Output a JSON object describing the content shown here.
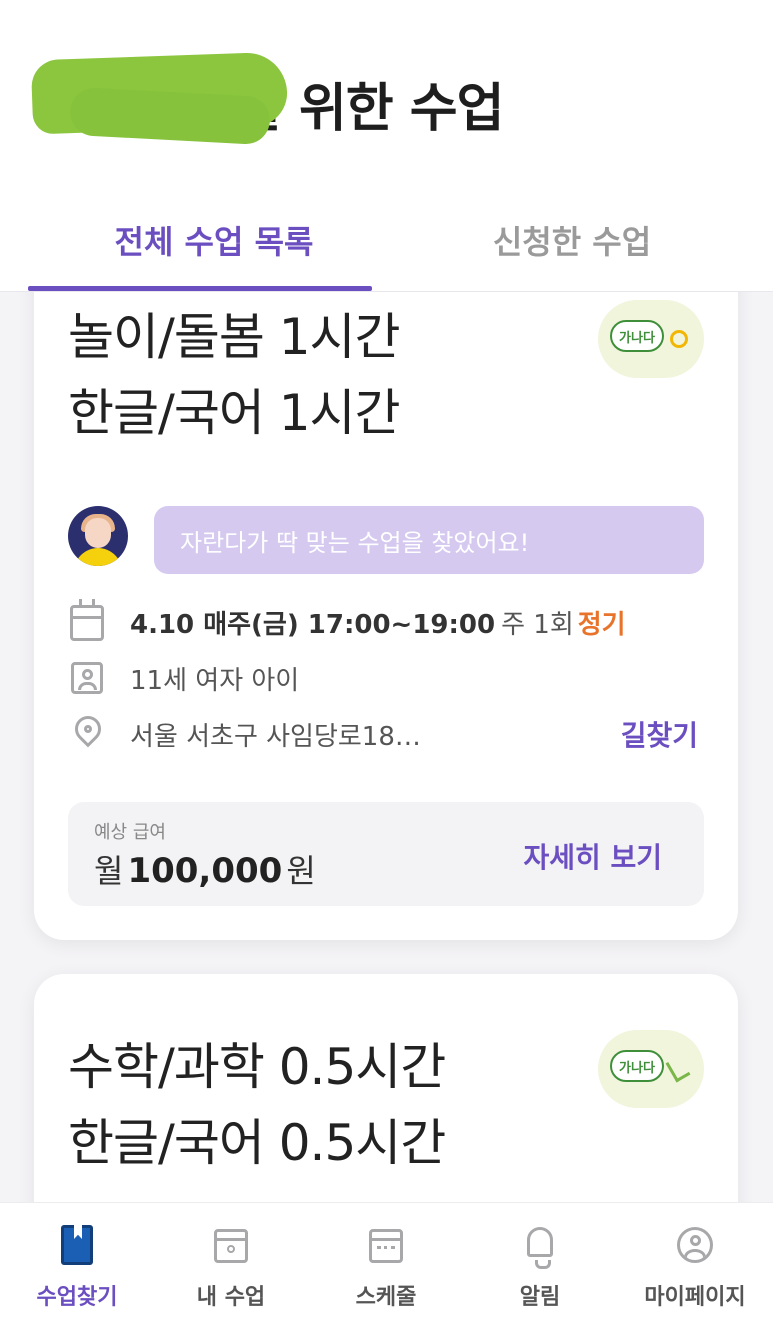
{
  "header": {
    "title": "을 위한 수업",
    "tabs": [
      "전체 수업 목록",
      "신청한 수업"
    ]
  },
  "cards": [
    {
      "subjects": [
        "놀이/돌봄 1시간",
        "한글/국어 1시간"
      ],
      "badge_text": "가나다",
      "message": "자란다가 딱 맞는 수업을 찾았어요!",
      "date": "4.10 매주(금) 17:00~19:00",
      "frequency": "주 1회",
      "type": "정기",
      "child": "11세 여자 아이",
      "address": "서울 서초구 사임당로18…",
      "route_label": "길찾기",
      "salary_label": "예상 급여",
      "salary_prefix": "월",
      "salary_amount": "100,000",
      "salary_unit": "원",
      "details_label": "자세히 보기"
    },
    {
      "subjects": [
        "수학/과학 0.5시간",
        "한글/국어 0.5시간"
      ],
      "badge_text": "가나다"
    }
  ],
  "bottom_nav": [
    {
      "label": "수업찾기",
      "icon": "book-icon",
      "active": true
    },
    {
      "label": "내 수업",
      "icon": "calendar-user-icon"
    },
    {
      "label": "스케줄",
      "icon": "calendar-icon"
    },
    {
      "label": "알림",
      "icon": "bell-icon"
    },
    {
      "label": "마이페이지",
      "icon": "user-circle-icon"
    }
  ],
  "colors": {
    "accent": "#6b4fc1",
    "orange": "#e8742b",
    "message_bg": "#d5c9f0",
    "redaction": "#8cc63f"
  }
}
